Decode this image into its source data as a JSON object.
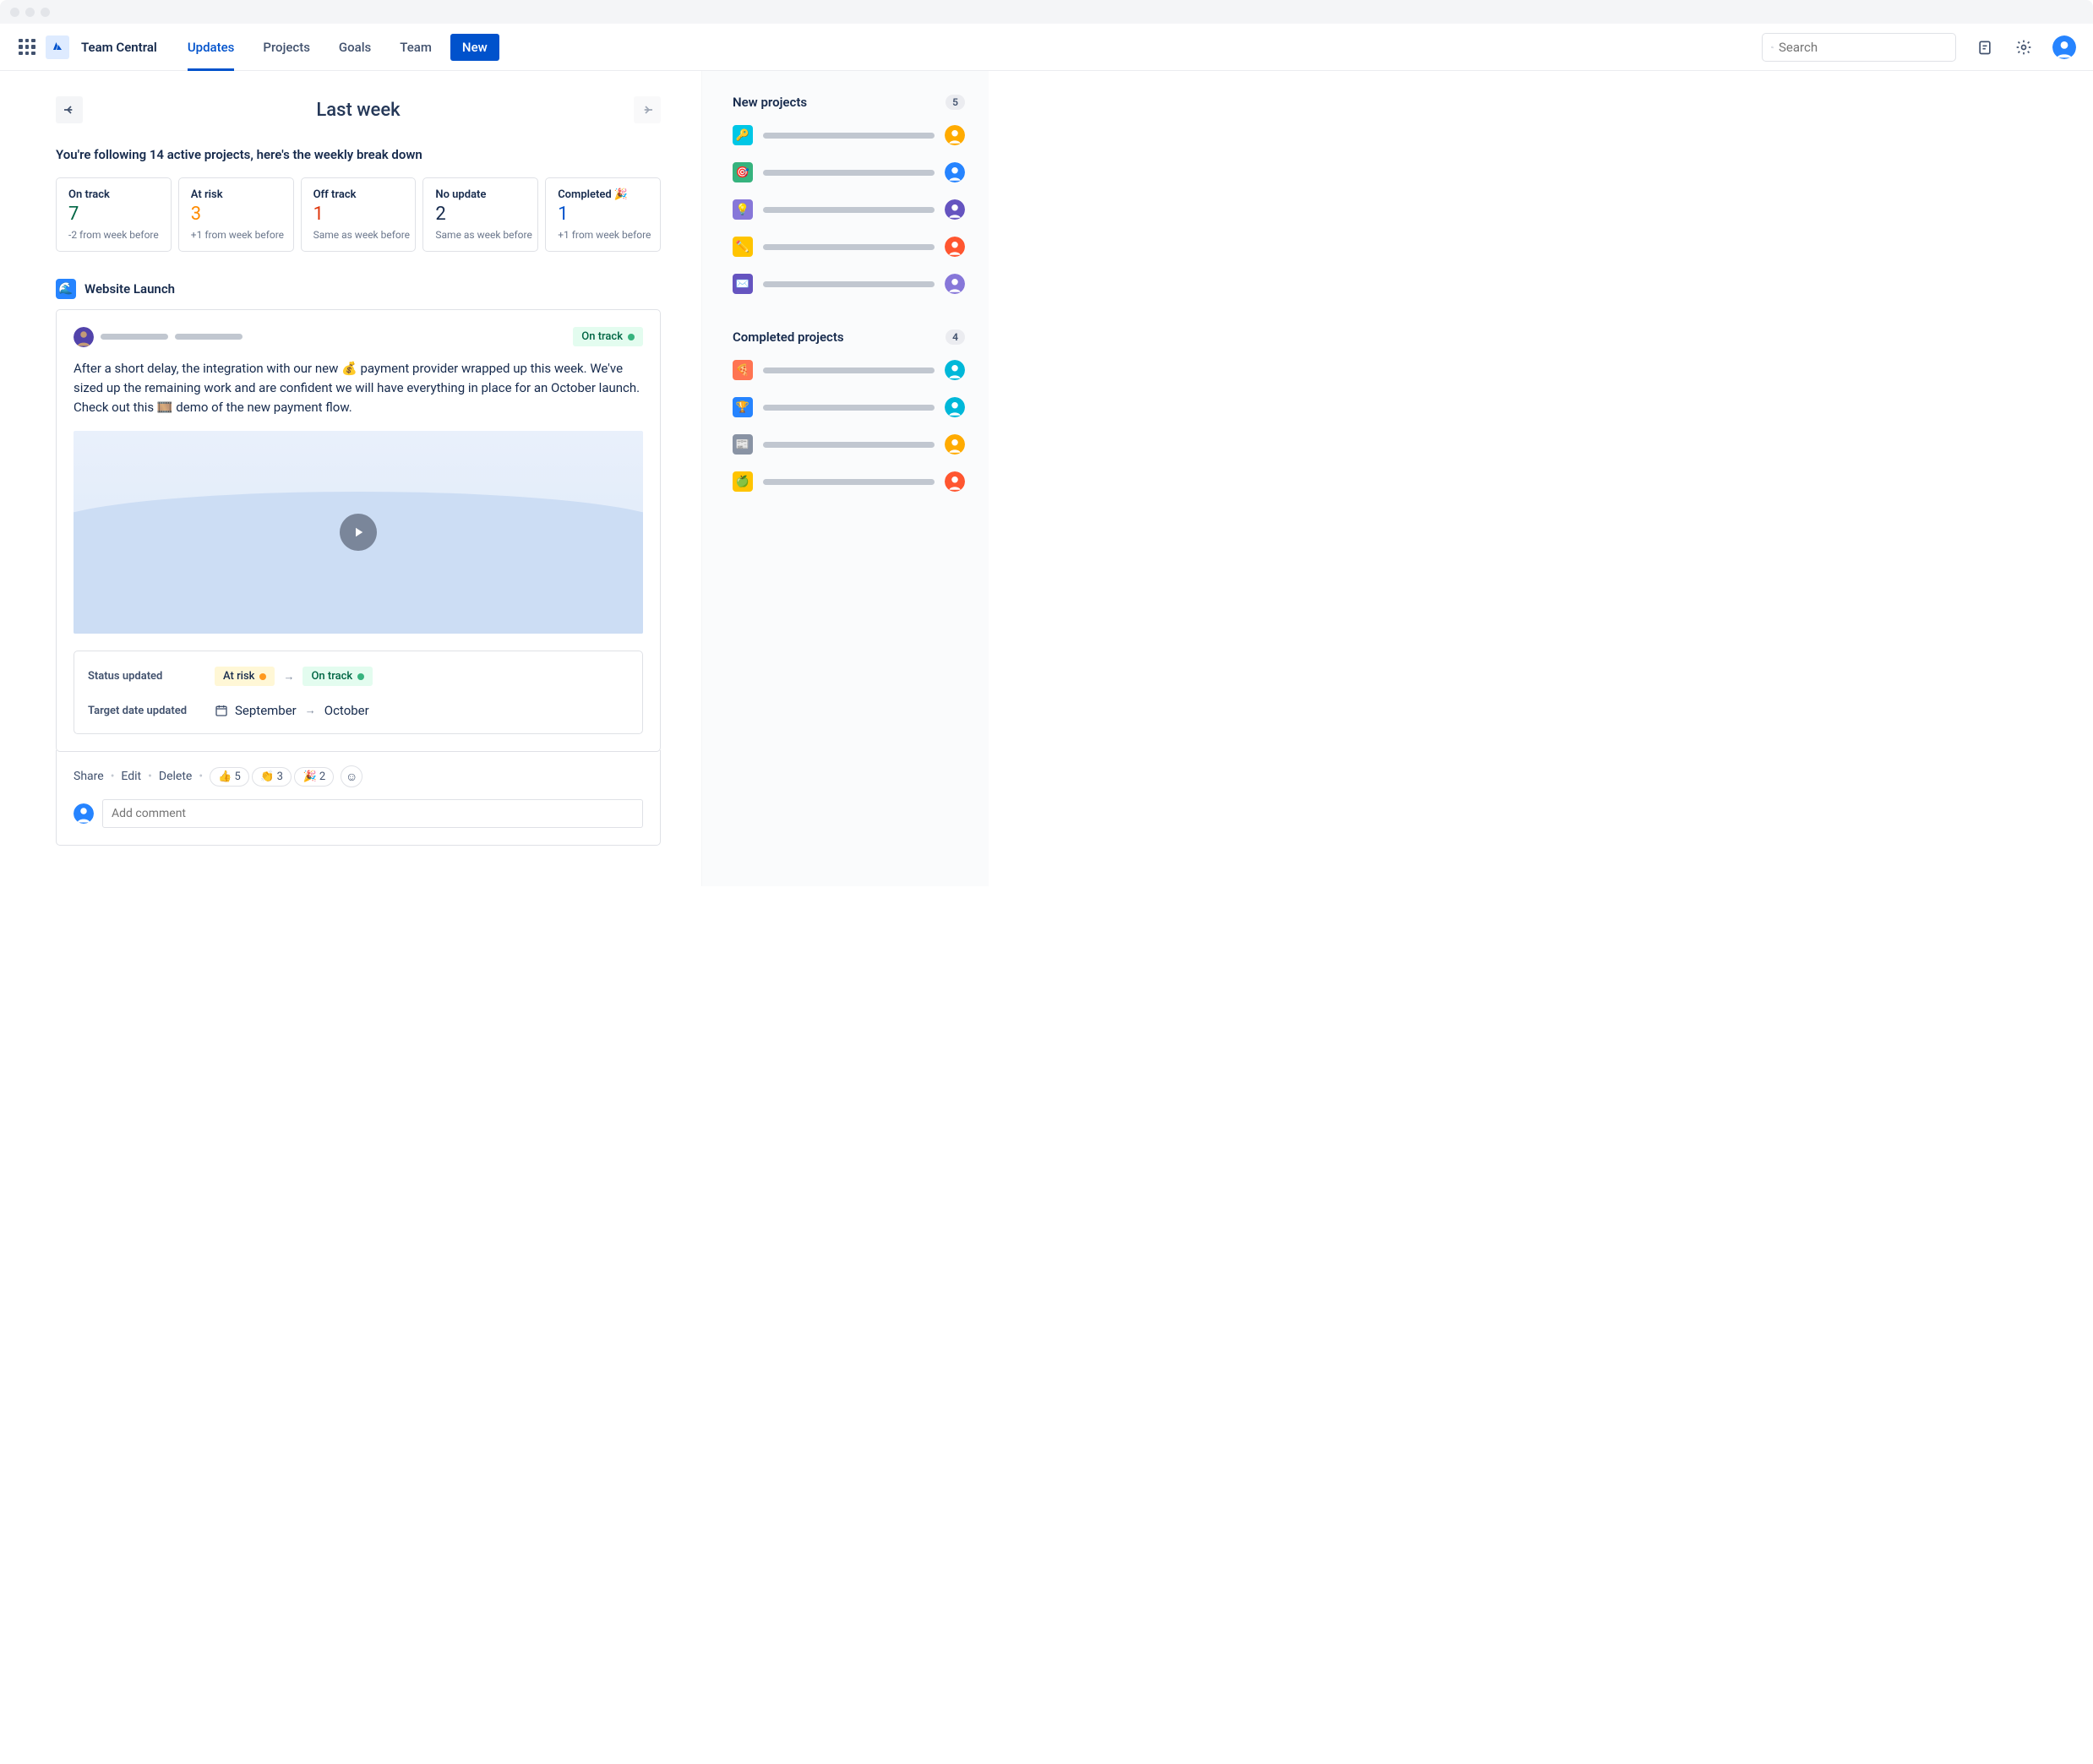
{
  "app_name": "Team Central",
  "nav": {
    "items": [
      "Updates",
      "Projects",
      "Goals",
      "Team"
    ],
    "active": "Updates",
    "new_btn": "New"
  },
  "search_placeholder": "Search",
  "header": {
    "title": "Last week"
  },
  "follow_line": "You're following 14 active projects, here's the weekly break down",
  "stats": [
    {
      "label": "On track",
      "value": "7",
      "delta": "-2 from week before",
      "color": "c-green"
    },
    {
      "label": "At risk",
      "value": "3",
      "delta": "+1 from week before",
      "color": "c-orange"
    },
    {
      "label": "Off track",
      "value": "1",
      "delta": "Same as week before",
      "color": "c-red"
    },
    {
      "label": "No update",
      "value": "2",
      "delta": "Same as week before",
      "color": "c-navy"
    },
    {
      "label": "Completed 🎉",
      "value": "1",
      "delta": "+1 from week before",
      "color": "c-blue"
    }
  ],
  "project": {
    "name": "Website Launch",
    "icon": "🌀",
    "status": "On track",
    "body": "After a short delay, the integration with our new 💰 payment provider wrapped up this week. We've sized up the remaining work and are confident we will have everything in place for an October launch. Check out this 🎞️ demo of the new payment flow.",
    "status_change": {
      "label": "Status updated",
      "from": "At risk",
      "to": "On track"
    },
    "date_change": {
      "label": "Target date updated",
      "from": "September",
      "to": "October"
    },
    "actions": {
      "share": "Share",
      "edit": "Edit",
      "delete": "Delete"
    },
    "reactions": [
      {
        "emoji": "👍",
        "count": "5"
      },
      {
        "emoji": "👏",
        "count": "3"
      },
      {
        "emoji": "🎉",
        "count": "2"
      }
    ],
    "comment_placeholder": "Add comment"
  },
  "sidebar": {
    "new_title": "New projects",
    "new_count": "5",
    "completed_title": "Completed projects",
    "completed_count": "4",
    "new_items": [
      {
        "bg": "#00C7E6",
        "emoji": "🔑",
        "av": "#FFAB00"
      },
      {
        "bg": "#36B37E",
        "emoji": "🎯",
        "av": "#2684FF"
      },
      {
        "bg": "#8777D9",
        "emoji": "💡",
        "av": "#6554C0"
      },
      {
        "bg": "#FFC400",
        "emoji": "✏️",
        "av": "#FF5630"
      },
      {
        "bg": "#6554C0",
        "emoji": "✉️",
        "av": "#8777D9"
      }
    ],
    "completed_items": [
      {
        "bg": "#FF7452",
        "emoji": "🍕",
        "av": "#00B8D9"
      },
      {
        "bg": "#2684FF",
        "emoji": "🏆",
        "av": "#00B8D9"
      },
      {
        "bg": "#8993A4",
        "emoji": "📰",
        "av": "#FFAB00"
      },
      {
        "bg": "#FFC400",
        "emoji": "🍏",
        "av": "#FF5630"
      }
    ]
  }
}
